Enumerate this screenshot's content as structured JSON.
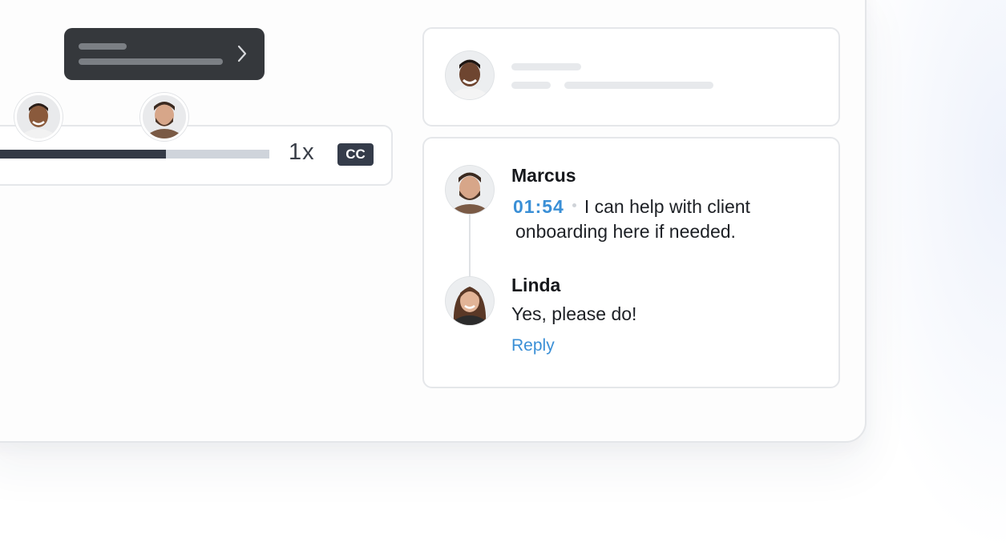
{
  "player": {
    "speed_label": "1x",
    "cc_label": "CC",
    "progress_fraction": 0.615
  },
  "tooltip": {
    "icon": "chevron-right-icon"
  },
  "comments": [
    {
      "author": "Marcus",
      "timestamp": "01:54",
      "line1": "I can help with client",
      "line2": "onboarding here if needed."
    },
    {
      "author": "Linda",
      "text": "Yes, please do!",
      "action": "Reply"
    }
  ],
  "colors": {
    "accent": "#3a8fd6",
    "tooltip_bg": "#35383c",
    "progress_fill": "#343a46",
    "progress_track": "#cfd4db"
  }
}
